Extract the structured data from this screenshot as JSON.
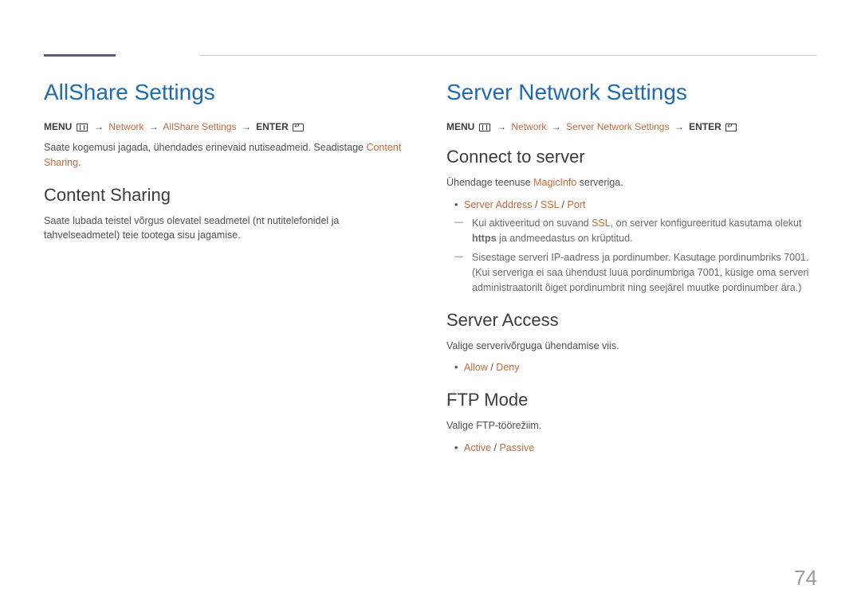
{
  "pageNumber": "74",
  "left": {
    "title": "AllShare Settings",
    "breadcrumb": {
      "menu": "MENU",
      "arrow": "→",
      "item1": "Network",
      "item2": "AllShare Settings",
      "enter": "ENTER"
    },
    "intro_a": "Saate kogemusi jagada, ühendades erinevaid nutiseadmeid. Seadistage ",
    "intro_hl": "Content Sharing",
    "intro_b": ".",
    "section1": {
      "title": "Content Sharing",
      "para": "Saate lubada teistel võrgus olevatel seadmetel (nt nutitelefonidel ja tahvelseadmetel) teie tootega sisu jagamise."
    }
  },
  "right": {
    "title": "Server Network Settings",
    "breadcrumb": {
      "menu": "MENU",
      "arrow": "→",
      "item1": "Network",
      "item2": "Server Network Settings",
      "enter": "ENTER"
    },
    "connect": {
      "title": "Connect to server",
      "para_a": "Ühendage teenuse ",
      "para_hl": "MagicInfo",
      "para_b": " serveriga.",
      "bullet_hl1": "Server Address",
      "bullet_sep": " / ",
      "bullet_hl2": "SSL",
      "bullet_hl3": "Port",
      "dash1_a": "Kui aktiveeritud on suvand ",
      "dash1_hl": "SSL",
      "dash1_b": ", on server konfigureeritud kasutama olekut ",
      "dash1_c": "https",
      "dash1_d": " ja andmeedastus on krüptitud.",
      "dash2": "Sisestage serveri IP-aadress ja pordinumber. Kasutage pordinumbriks 7001. (Kui serveriga ei saa ühendust luua pordinumbriga 7001, küsige oma serveri administraatorilt õiget pordinumbrit ning seejärel muutke pordinumber ära.)"
    },
    "access": {
      "title": "Server Access",
      "para": "Valige serverivõrguga ühendamise viis.",
      "opt1": "Allow",
      "sep": " / ",
      "opt2": "Deny"
    },
    "ftp": {
      "title": "FTP Mode",
      "para": "Valige FTP-töörežiim.",
      "opt1": "Active",
      "sep": " / ",
      "opt2": "Passive"
    }
  }
}
